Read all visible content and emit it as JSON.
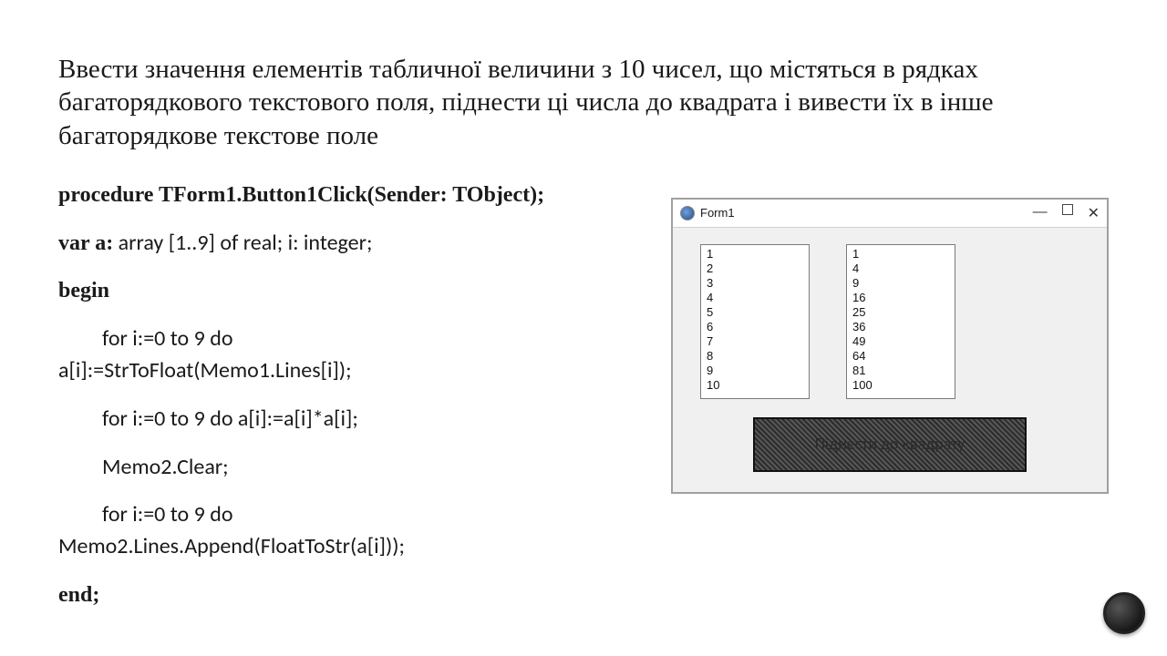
{
  "heading": "Ввести значення елементів табличної величини з 10 чисел, що містяться в рядках багаторядкового текстового поля, піднести ці числа до квадрата і вивести їх в інше багаторядкове текстове поле",
  "code": {
    "l1_bold": "procedure TForm1.Button1Click(Sender: TObject);",
    "l2_bold": "var a:",
    "l2_sans": " array [1..9] of real; i: integer;",
    "l3_bold": "begin",
    "l4_sans_a": "for i:=0 to 9 do",
    "l4_sans_b": "a[i]:=StrToFloat(Memo1.Lines[i]);",
    "l5_sans": "for i:=0 to 9 do a[i]:=a[i]*a[i];",
    "l6_sans": "Memo2.Clear;",
    "l7_sans_a": "for i:=0 to 9 do",
    "l7_sans_b": "Memo2.Lines.Append(FloatToStr(a[i]));",
    "l8_bold": "end;"
  },
  "form": {
    "title": "Form1",
    "minimize": "—",
    "close": "✕",
    "memo1": [
      "1",
      "2",
      "3",
      "4",
      "5",
      "6",
      "7",
      "8",
      "9",
      "10"
    ],
    "memo2": [
      "1",
      "4",
      "9",
      "16",
      "25",
      "36",
      "49",
      "64",
      "81",
      "100"
    ],
    "button": "Піднести до квадрату"
  }
}
